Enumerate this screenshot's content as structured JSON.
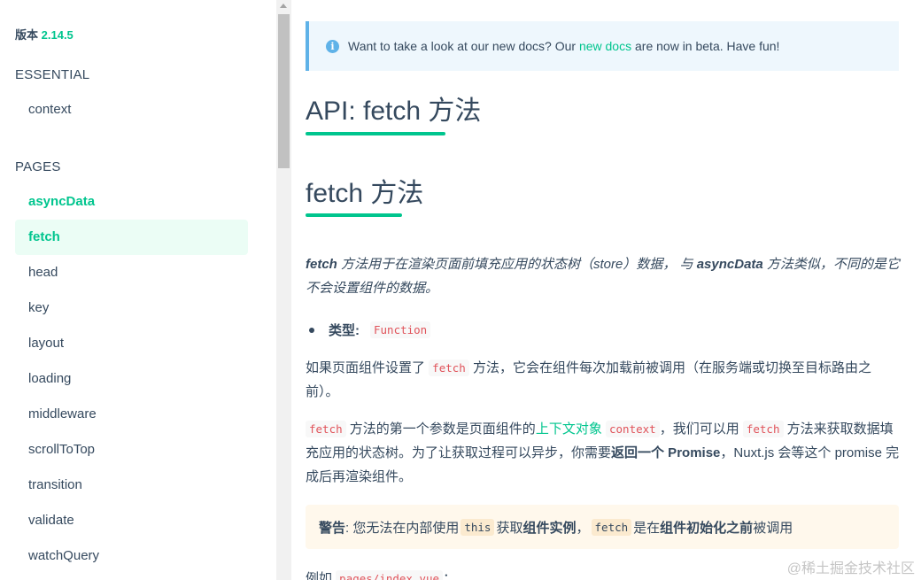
{
  "sidebar": {
    "version_label": "版本",
    "version_number": "2.14.5",
    "sections": [
      {
        "title": "ESSENTIAL",
        "items": [
          {
            "label": "context"
          }
        ]
      },
      {
        "title": "PAGES",
        "items": [
          {
            "label": "asyncData"
          },
          {
            "label": "fetch"
          },
          {
            "label": "head"
          },
          {
            "label": "key"
          },
          {
            "label": "layout"
          },
          {
            "label": "loading"
          },
          {
            "label": "middleware"
          },
          {
            "label": "scrollToTop"
          },
          {
            "label": "transition"
          },
          {
            "label": "validate"
          },
          {
            "label": "watchQuery"
          }
        ]
      }
    ]
  },
  "notice": {
    "text_before": "Want to take a look at our new docs? Our ",
    "link": "new docs",
    "text_after": " are now in beta. Have fun!"
  },
  "page_title": "API: fetch 方法",
  "section_title": "fetch 方法",
  "intro": {
    "p1": "fetch",
    "p2": " 方法用于在渲染页面前填充应用的状态树（store）数据， 与 ",
    "p3": "asyncData",
    "p4": " 方法类似，不同的是它不会设置组件的数据。"
  },
  "type_item": {
    "label": "类型:",
    "value": "Function"
  },
  "para1": {
    "p1": "如果页面组件设置了 ",
    "code": "fetch",
    "p2": " 方法，它会在组件每次加载前被调用（在服务端或切换至目标路由之前）。"
  },
  "para2": {
    "code1": "fetch",
    "p1": " 方法的第一个参数是页面组件的",
    "link": "上下文对象",
    "code2": "context",
    "p2": "，我们可以用 ",
    "code3": "fetch",
    "p3": " 方法来获取数据填充应用的状态树。为了让获取过程可以异步，你需要",
    "b1": "返回一个 Promise",
    "p4": "，Nuxt.js 会等这个 promise 完成后再渲染组件。"
  },
  "warning": {
    "label": "警告",
    "p1": ": 您无法在内部使用",
    "code1": "this",
    "p2": "获取",
    "b1": "组件实例",
    "p3": "，",
    "code2": "fetch",
    "p4": "是在",
    "b2": "组件初始化之前",
    "p5": "被调用"
  },
  "example": {
    "p1": "例如 ",
    "code": "pages/index.vue",
    "p2": "："
  },
  "watermark": "@稀土掘金技术社区",
  "colors": {
    "accent": "#00c58e",
    "text": "#35495e",
    "info": "#5fb2e8",
    "warning_bg": "#fff8ec"
  }
}
